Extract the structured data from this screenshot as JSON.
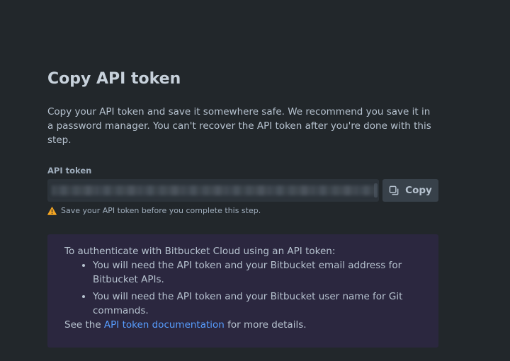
{
  "title": "Copy API token",
  "description": "Copy your API token and save it somewhere safe. We recommend you save it in a password manager. You can't recover the API token after you're done with this step.",
  "token_field": {
    "label": "API token"
  },
  "copy_button": {
    "label": "Copy",
    "icon": "copy-icon"
  },
  "warning": {
    "icon": "warning-icon",
    "text": "Save your API token before you complete this step.",
    "color": "#f5a623"
  },
  "info": {
    "intro": "To authenticate with Bitbucket Cloud using an API token:",
    "bullets": [
      "You will need the API token and your Bitbucket email address for Bitbucket APIs.",
      "You will need the API token and your Bitbucket user name for Git commands."
    ],
    "see_prefix": "See the ",
    "link_text": "API token documentation",
    "see_suffix": " for more details."
  },
  "colors": {
    "background": "#22272b",
    "info_background": "#2b273f",
    "link": "#579dff"
  }
}
